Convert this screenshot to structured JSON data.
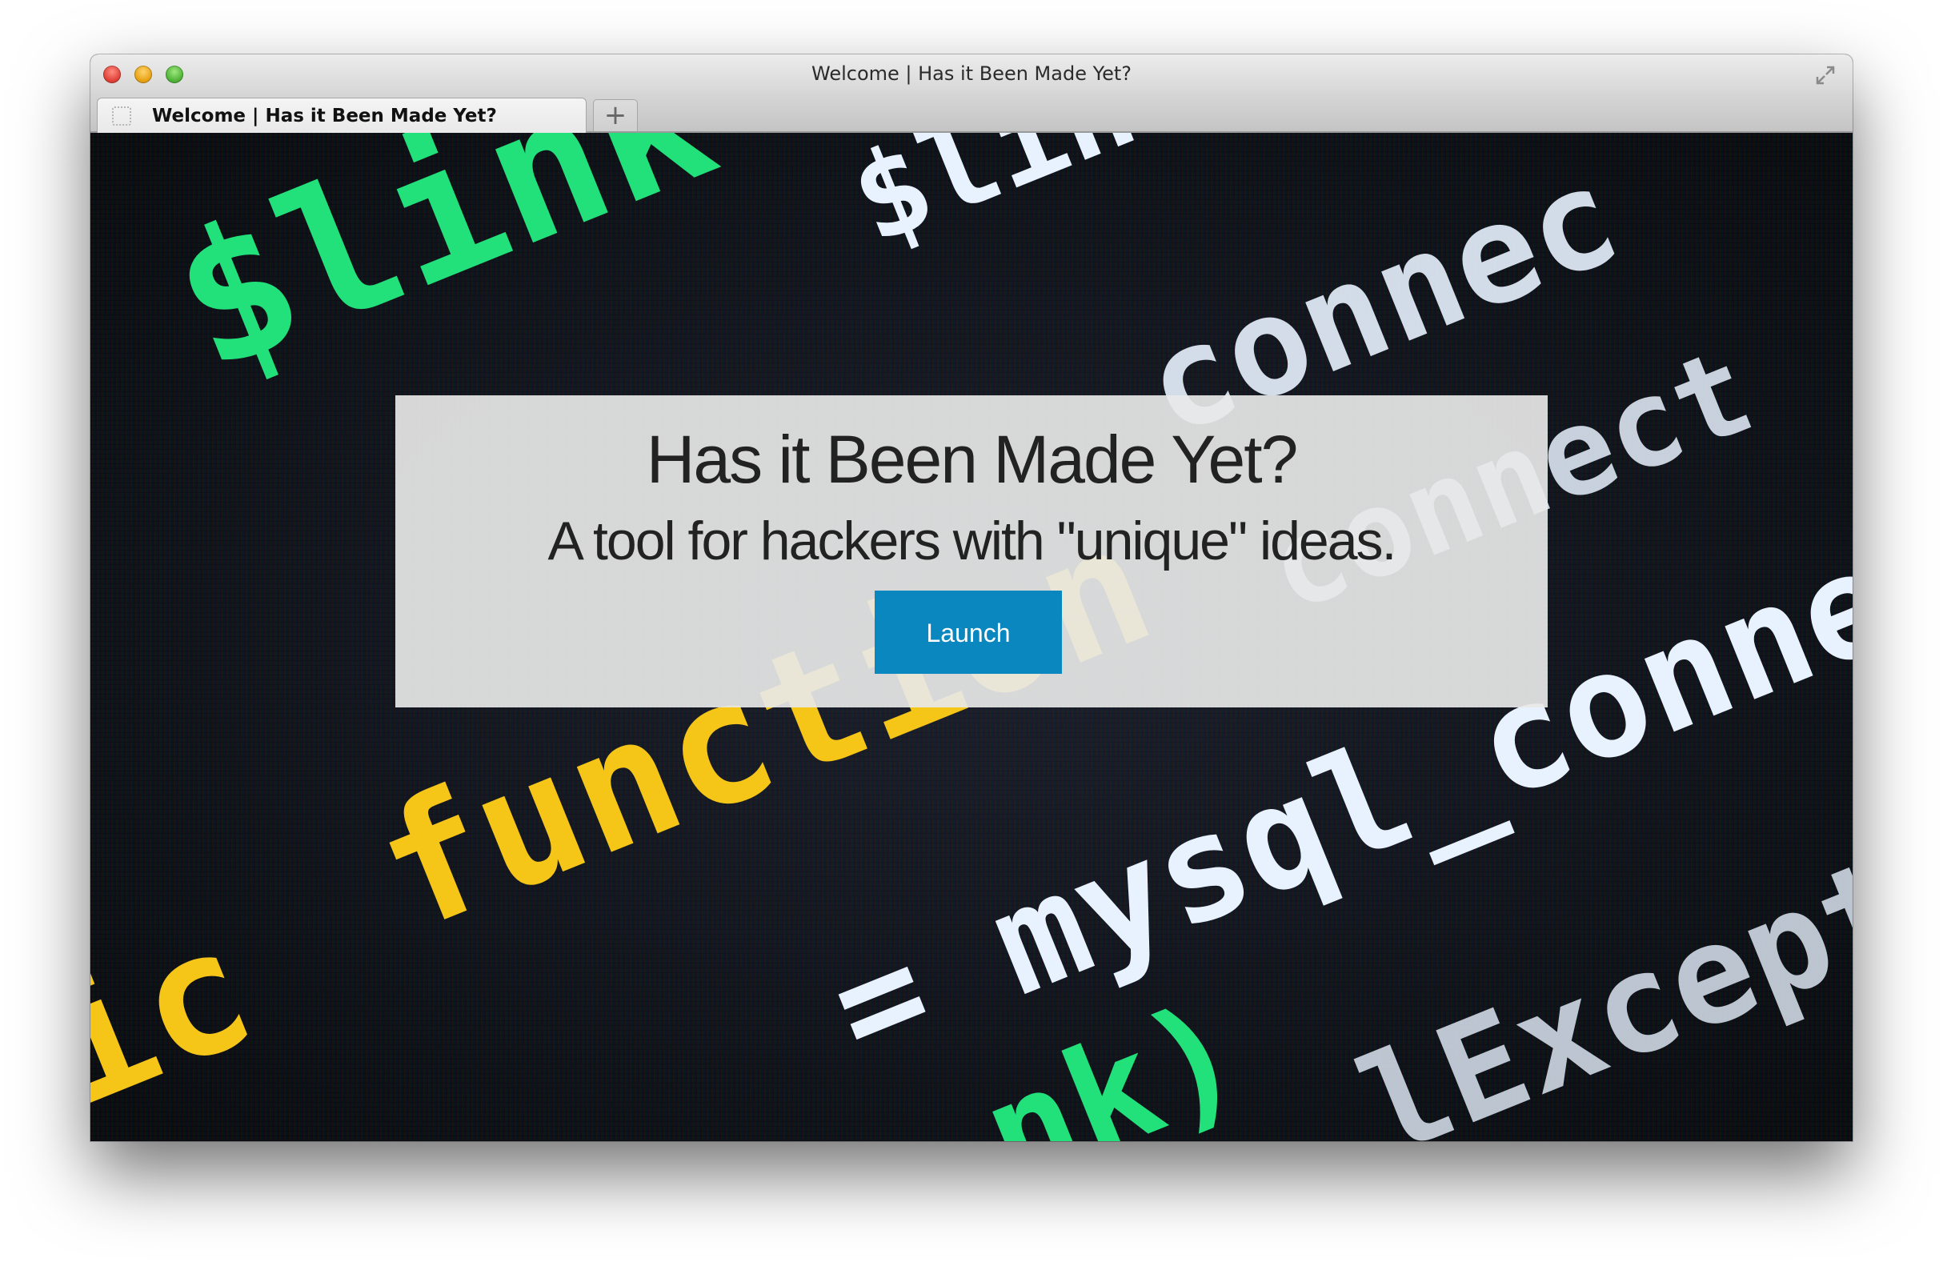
{
  "window": {
    "title": "Welcome | Has it Been Made Yet?"
  },
  "tabs": [
    {
      "label": "Welcome | Has it Been Made Yet?",
      "active": true
    }
  ],
  "new_tab_label": "+",
  "hero": {
    "title": "Has it Been Made Yet?",
    "subtitle": "A tool for hackers with \"unique\" ideas.",
    "button_label": "Launch"
  },
  "background": {
    "code_fragments": [
      "$link =",
      "$link",
      "connec",
      "function",
      "ic",
      "func",
      "= mysql_connect",
      "connect",
      "=",
      "nk)",
      "lExcept"
    ]
  },
  "colors": {
    "button": "#0b87bf",
    "hero_panel": "#e8e8e8",
    "code_green": "#22e07a",
    "code_yellow": "#f5c518",
    "code_white": "#e8f2ff"
  },
  "icons": {
    "close": "red-traffic-light",
    "minimize": "yellow-traffic-light",
    "maximize": "green-traffic-light",
    "fullscreen": "diagonal-arrows",
    "favicon": "blank-page"
  }
}
